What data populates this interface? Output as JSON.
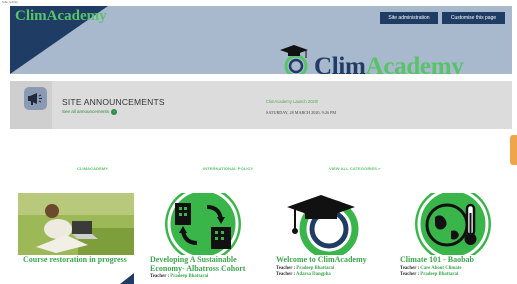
{
  "browser": {
    "tiny_text": "Site Admin"
  },
  "header": {
    "site_name": "ClimAcademy",
    "admin_button": "Site administration",
    "customise_button": "Customise this page",
    "logo_text_1": "Clim",
    "logo_text_2": "Academy",
    "colors": {
      "bar": "#a8b8cd",
      "navy": "#1f3c64",
      "green": "#58c368"
    }
  },
  "announcements": {
    "title": "SITE ANNOUNCEMENTS",
    "see_all": "See all announcements",
    "post_title": "ClimAcademy Launch 2020!",
    "post_date": "SATURDAY, 28 MARCH 2020, 9:26 PM"
  },
  "categories": {
    "items": [
      "CLIMACADEMY",
      "INTERNATIONAL POLICY"
    ],
    "view_all": "VIEW ALL CATEGORIES »"
  },
  "courses": [
    {
      "title": "Course restoration in progress",
      "teachers": [],
      "image": "photo-person-laptop"
    },
    {
      "title": "Developing A Sustainable Economy- Albatross Cohort",
      "teachers": [
        {
          "label": "Teacher :",
          "name": "Pradeep Bhattarai"
        }
      ],
      "image": "buildings-icon"
    },
    {
      "title": "Welcome to ClimAcademy",
      "teachers": [
        {
          "label": "Teacher :",
          "name": "Pradeep Bhattarai"
        },
        {
          "label": "Teacher :",
          "name": "Adarsa Dangpha"
        }
      ],
      "image": "graduation-cap-icon"
    },
    {
      "title": "Climate 101 - Baobab",
      "teachers": [
        {
          "label": "Teacher :",
          "name": "Care About Climate"
        },
        {
          "label": "Teacher :",
          "name": "Pradeep Bhattarai"
        }
      ],
      "image": "earth-thermometer-icon"
    }
  ]
}
